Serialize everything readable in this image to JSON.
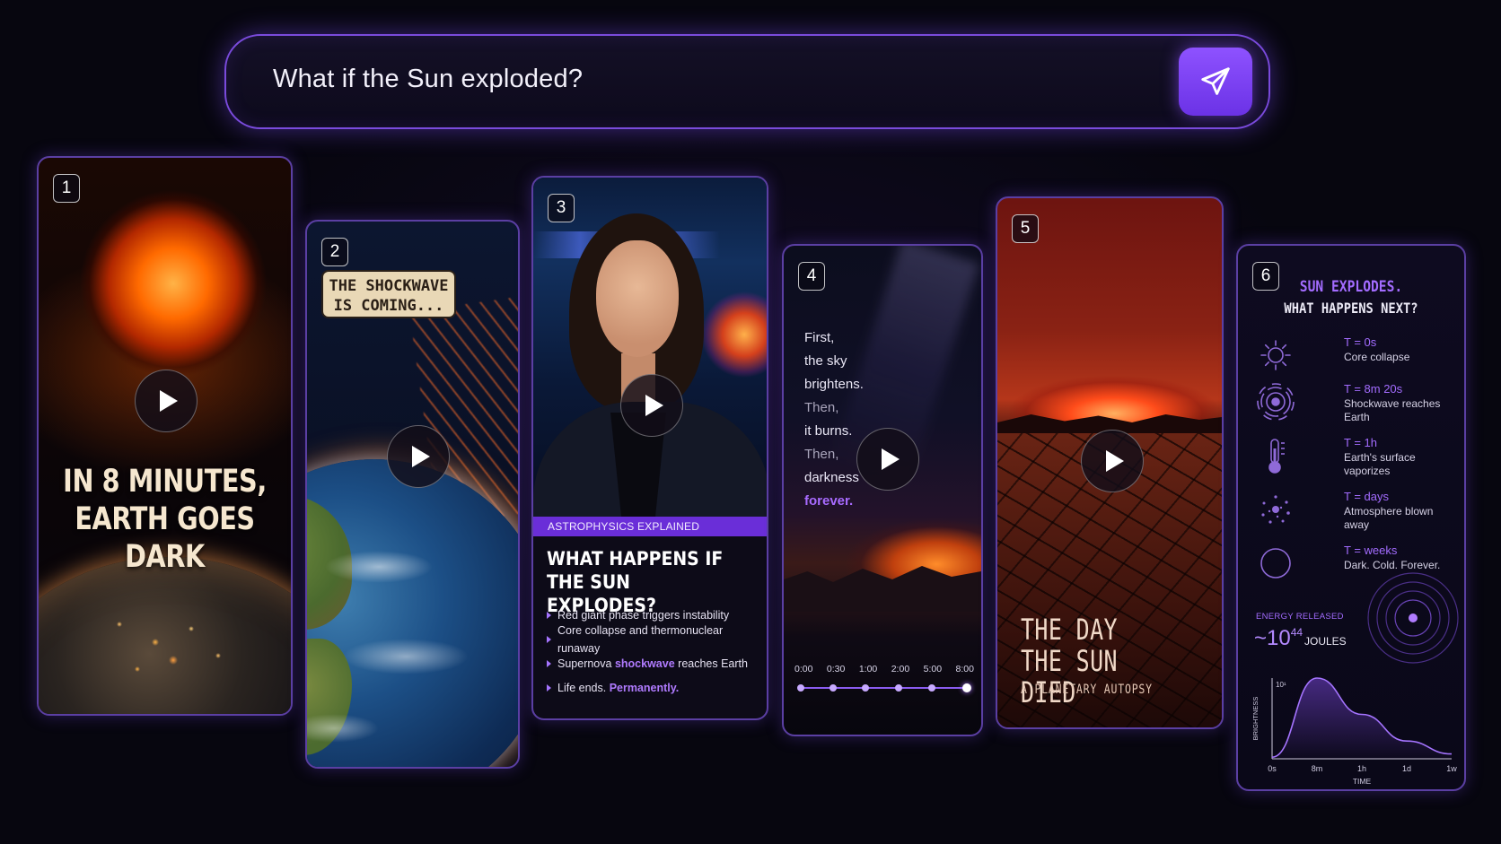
{
  "search": {
    "query": "What if the Sun exploded?"
  },
  "cards": [
    {
      "number": "1",
      "headline_line1": "IN 8 MINUTES,",
      "headline_line2": "EARTH GOES DARK"
    },
    {
      "number": "2",
      "bubble_line1": "THE SHOCKWAVE",
      "bubble_line2": "IS COMING..."
    },
    {
      "number": "3",
      "category": "ASTROPHYSICS EXPLAINED",
      "title_line1": "WHAT HAPPENS IF",
      "title_line2": "THE SUN EXPLODES?",
      "bullets": [
        {
          "pre": "Red giant phase triggers instability",
          "hl": "",
          "post": ""
        },
        {
          "pre": "Core collapse and thermonuclear runaway",
          "hl": "",
          "post": ""
        },
        {
          "pre": "Supernova ",
          "hl": "shockwave",
          "post": " reaches Earth"
        },
        {
          "pre": "Life ends. ",
          "hl": "Permanently.",
          "post": ""
        }
      ]
    },
    {
      "number": "4",
      "lines": [
        "First,",
        "the sky",
        "brightens.",
        "Then,",
        "it burns.",
        "Then,",
        "darkness",
        "forever."
      ],
      "timeline": [
        "0:00",
        "0:30",
        "1:00",
        "2:00",
        "5:00",
        "8:00"
      ]
    },
    {
      "number": "5",
      "title_line1": "THE DAY",
      "title_line2": "THE SUN DIED",
      "subtitle": "A PLANETARY AUTOPSY"
    },
    {
      "number": "6",
      "title": "SUN EXPLODES.",
      "subtitle": "WHAT HAPPENS NEXT?",
      "events": [
        {
          "time": "T = 0s",
          "desc": "Core collapse",
          "icon": "sun-icon"
        },
        {
          "time": "T = 8m 20s",
          "desc": "Shockwave reaches Earth",
          "icon": "shockwave-icon"
        },
        {
          "time": "T = 1h",
          "desc": "Earth's surface vaporizes",
          "icon": "thermometer-icon"
        },
        {
          "time": "T = days",
          "desc": "Atmosphere blown away",
          "icon": "scatter-icon"
        },
        {
          "time": "T = weeks",
          "desc": "Dark. Cold. Forever.",
          "icon": "empty-circle-icon"
        }
      ],
      "energy_label": "ENERGY RELEASED",
      "energy_prefix": "~10",
      "energy_exp": "44",
      "energy_unit": "JOULES"
    }
  ],
  "colors": {
    "accent": "#8e52ff",
    "accent_text": "#a36cff",
    "card_border": "#5b3fa3",
    "background": "#07060f"
  },
  "chart_data": {
    "type": "area",
    "title": "",
    "xlabel": "TIME",
    "ylabel": "BRIGHTNESS",
    "x": [
      "0s",
      "8m",
      "1h",
      "1d",
      "1w"
    ],
    "y_tick_labels": [
      "10¹"
    ],
    "series": [
      {
        "values": [
          0.02,
          1.0,
          0.55,
          0.22,
          0.06
        ]
      }
    ],
    "ylim": [
      0,
      1
    ],
    "grid": false
  }
}
